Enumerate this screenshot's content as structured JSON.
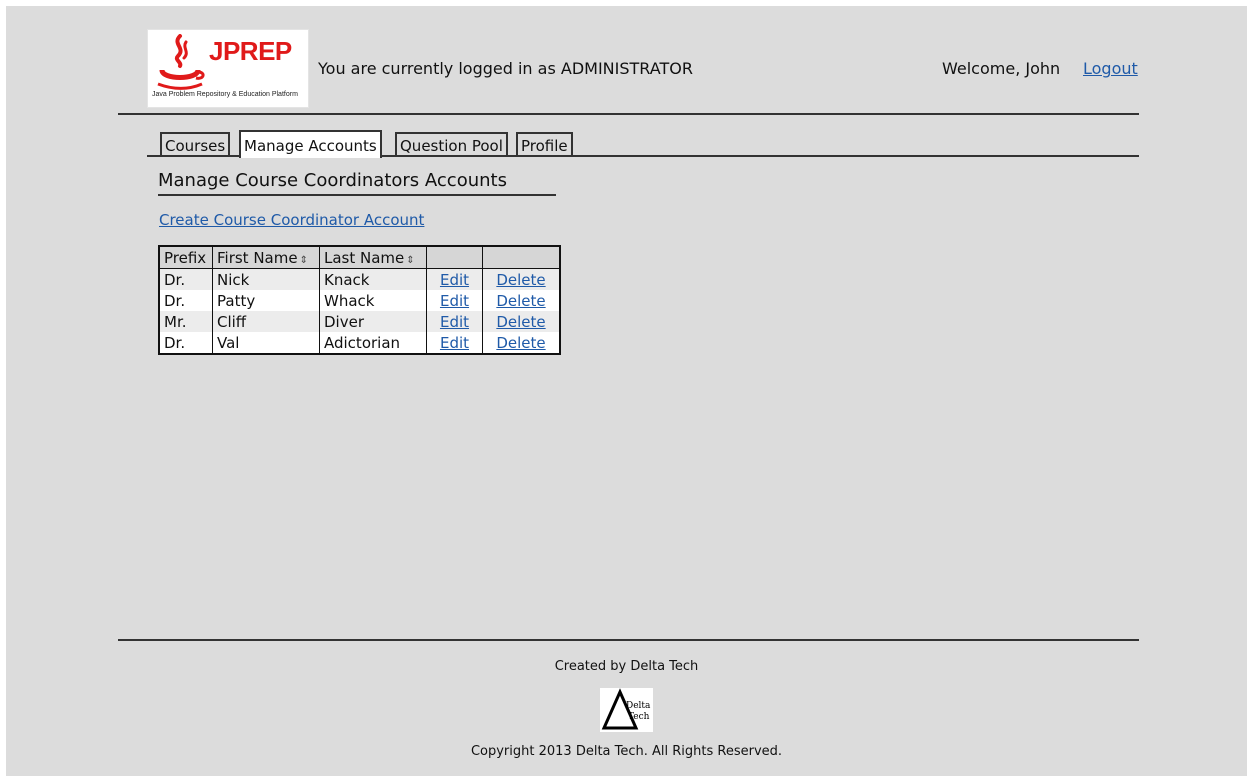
{
  "header": {
    "logo_title": "JPREP",
    "logo_subtitle": "Java Problem Repository & Education Platform",
    "login_status": "You are currently logged in as ADMINISTRATOR",
    "welcome": "Welcome, John",
    "logout": "Logout"
  },
  "tabs": [
    {
      "label": "Courses"
    },
    {
      "label": "Manage Accounts"
    },
    {
      "label": "Question Pool"
    },
    {
      "label": "Profile"
    }
  ],
  "main": {
    "title": "Manage Course Coordinators Accounts",
    "create_link": "Create Course Coordinator Account",
    "table": {
      "headers": [
        "Prefix",
        "First Name",
        "Last Name",
        "",
        ""
      ],
      "sort_icon": "⇕",
      "rows": [
        {
          "prefix": "Dr.",
          "first": "Nick",
          "last": "Knack",
          "edit": "Edit",
          "delete": "Delete"
        },
        {
          "prefix": "Dr.",
          "first": "Patty",
          "last": "Whack",
          "edit": "Edit",
          "delete": "Delete"
        },
        {
          "prefix": "Mr.",
          "first": "Cliff",
          "last": "Diver",
          "edit": "Edit",
          "delete": "Delete"
        },
        {
          "prefix": "Dr.",
          "first": "Val",
          "last": "Adictorian",
          "edit": "Edit",
          "delete": "Delete"
        }
      ]
    }
  },
  "footer": {
    "created_by": "Created by Delta Tech",
    "logo_word1": "Delta",
    "logo_word2": "Tech",
    "copyright": "Copyright 2013 Delta Tech. All Rights Reserved."
  },
  "colors": {
    "brand_red": "#e01a1a",
    "link_blue": "#1f5aa8",
    "background": "#dcdcdc"
  },
  "icons": [
    "java-cup-logo-icon",
    "sort-icon",
    "delta-logo-icon"
  ]
}
